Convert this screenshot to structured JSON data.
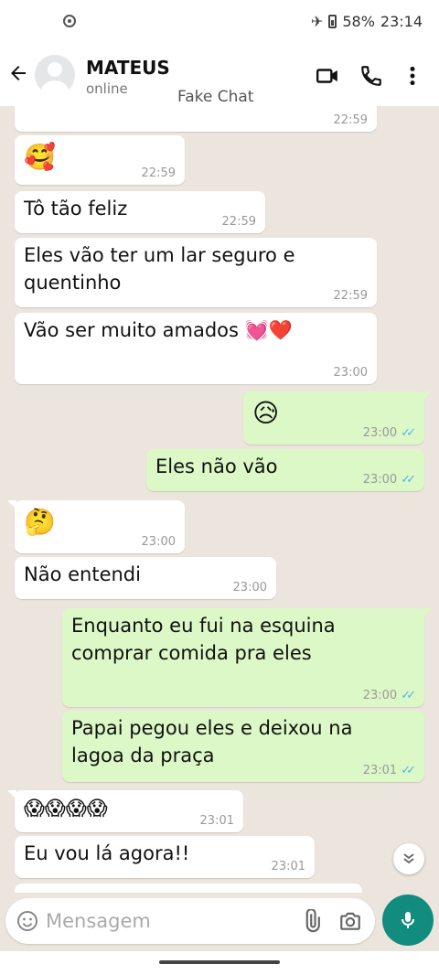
{
  "statusbar": {
    "battery": "58%",
    "time": "23:14"
  },
  "header": {
    "name": "MATEUS",
    "status": "online",
    "watermark": "Fake Chat"
  },
  "messages": [
    {
      "dir": "in",
      "text": "",
      "time": "22:59"
    },
    {
      "dir": "in",
      "text": "🥰",
      "time": "22:59"
    },
    {
      "dir": "in",
      "text": "Tô tão feliz",
      "time": "22:59"
    },
    {
      "dir": "in",
      "text": "Eles vão ter um lar seguro e quentinho",
      "time": "22:59"
    },
    {
      "dir": "in",
      "text": "Vão ser muito amados 💓❤️",
      "time": "23:00"
    },
    {
      "dir": "out",
      "text": "😥",
      "time": "23:00"
    },
    {
      "dir": "out",
      "text": "Eles não vão",
      "time": "23:00"
    },
    {
      "dir": "in",
      "text": "🤔",
      "time": "23:00"
    },
    {
      "dir": "in",
      "text": "Não entendi",
      "time": "23:00"
    },
    {
      "dir": "out",
      "text": "Enquanto eu fui na esquina comprar comida pra eles",
      "time": "23:00"
    },
    {
      "dir": "out",
      "text": "Papai pegou eles e deixou na lagoa da praça",
      "time": "23:01"
    },
    {
      "dir": "in",
      "text": "😱😱😱😱",
      "time": "23:01"
    },
    {
      "dir": "in",
      "text": "Eu vou lá agora!!",
      "time": "23:01"
    }
  ],
  "input": {
    "placeholder": "Mensagem"
  },
  "colors": {
    "incoming": "#FFFFFF",
    "outgoing": "#DCF8C6",
    "accent": "#128C7E",
    "ticks": "#4FB6EC"
  },
  "icons": {
    "back": "arrow-left-icon",
    "video": "video-camera-icon",
    "call": "phone-icon",
    "more": "more-vertical-icon",
    "emoji": "smiley-icon",
    "attach": "paperclip-icon",
    "camera": "camera-icon",
    "mic": "microphone-icon",
    "scroll": "double-chevron-down-icon"
  }
}
